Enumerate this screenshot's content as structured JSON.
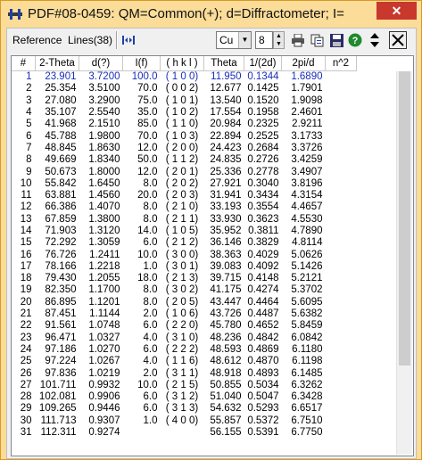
{
  "window": {
    "title": "PDF#08-0459: QM=Common(+); d=Diffractometer; I=...",
    "close_label": "✕"
  },
  "toolbar": {
    "reference_label": "Reference",
    "lines_label": "Lines(38)",
    "element_value": "Cu",
    "number_value": "8"
  },
  "table": {
    "columns": [
      "#",
      "2-Theta",
      "d(?)",
      "I(f)",
      "( h k l )",
      "Theta",
      "1/(2d)",
      "2pi/d",
      "n^2"
    ],
    "rows": [
      [
        "1",
        "23.901",
        "3.7200",
        "100.0",
        "( 1 0 0)",
        "11.950",
        "0.1344",
        "1.6890",
        ""
      ],
      [
        "2",
        "25.354",
        "3.5100",
        "70.0",
        "( 0 0 2)",
        "12.677",
        "0.1425",
        "1.7901",
        ""
      ],
      [
        "3",
        "27.080",
        "3.2900",
        "75.0",
        "( 1 0 1)",
        "13.540",
        "0.1520",
        "1.9098",
        ""
      ],
      [
        "4",
        "35.107",
        "2.5540",
        "35.0",
        "( 1 0 2)",
        "17.554",
        "0.1958",
        "2.4601",
        ""
      ],
      [
        "5",
        "41.968",
        "2.1510",
        "85.0",
        "( 1 1 0)",
        "20.984",
        "0.2325",
        "2.9211",
        ""
      ],
      [
        "6",
        "45.788",
        "1.9800",
        "70.0",
        "( 1 0 3)",
        "22.894",
        "0.2525",
        "3.1733",
        ""
      ],
      [
        "7",
        "48.845",
        "1.8630",
        "12.0",
        "( 2 0 0)",
        "24.423",
        "0.2684",
        "3.3726",
        ""
      ],
      [
        "8",
        "49.669",
        "1.8340",
        "50.0",
        "( 1 1 2)",
        "24.835",
        "0.2726",
        "3.4259",
        ""
      ],
      [
        "9",
        "50.673",
        "1.8000",
        "12.0",
        "( 2 0 1)",
        "25.336",
        "0.2778",
        "3.4907",
        ""
      ],
      [
        "10",
        "55.842",
        "1.6450",
        "8.0",
        "( 2 0 2)",
        "27.921",
        "0.3040",
        "3.8196",
        ""
      ],
      [
        "11",
        "63.881",
        "1.4560",
        "20.0",
        "( 2 0 3)",
        "31.941",
        "0.3434",
        "4.3154",
        ""
      ],
      [
        "12",
        "66.386",
        "1.4070",
        "8.0",
        "( 2 1 0)",
        "33.193",
        "0.3554",
        "4.4657",
        ""
      ],
      [
        "13",
        "67.859",
        "1.3800",
        "8.0",
        "( 2 1 1)",
        "33.930",
        "0.3623",
        "4.5530",
        ""
      ],
      [
        "14",
        "71.903",
        "1.3120",
        "14.0",
        "( 1 0 5)",
        "35.952",
        "0.3811",
        "4.7890",
        ""
      ],
      [
        "15",
        "72.292",
        "1.3059",
        "6.0",
        "( 2 1 2)",
        "36.146",
        "0.3829",
        "4.8114",
        ""
      ],
      [
        "16",
        "76.726",
        "1.2411",
        "10.0",
        "( 3 0 0)",
        "38.363",
        "0.4029",
        "5.0626",
        ""
      ],
      [
        "17",
        "78.166",
        "1.2218",
        "1.0",
        "( 3 0 1)",
        "39.083",
        "0.4092",
        "5.1426",
        ""
      ],
      [
        "18",
        "79.430",
        "1.2055",
        "18.0",
        "( 2 1 3)",
        "39.715",
        "0.4148",
        "5.2121",
        ""
      ],
      [
        "19",
        "82.350",
        "1.1700",
        "8.0",
        "( 3 0 2)",
        "41.175",
        "0.4274",
        "5.3702",
        ""
      ],
      [
        "20",
        "86.895",
        "1.1201",
        "8.0",
        "( 2 0 5)",
        "43.447",
        "0.4464",
        "5.6095",
        ""
      ],
      [
        "21",
        "87.451",
        "1.1144",
        "2.0",
        "( 1 0 6)",
        "43.726",
        "0.4487",
        "5.6382",
        ""
      ],
      [
        "22",
        "91.561",
        "1.0748",
        "6.0",
        "( 2 2 0)",
        "45.780",
        "0.4652",
        "5.8459",
        ""
      ],
      [
        "23",
        "96.471",
        "1.0327",
        "4.0",
        "( 3 1 0)",
        "48.236",
        "0.4842",
        "6.0842",
        ""
      ],
      [
        "24",
        "97.186",
        "1.0270",
        "6.0",
        "( 2 2 2)",
        "48.593",
        "0.4869",
        "6.1180",
        ""
      ],
      [
        "25",
        "97.224",
        "1.0267",
        "4.0",
        "( 1 1 6)",
        "48.612",
        "0.4870",
        "6.1198",
        ""
      ],
      [
        "26",
        "97.836",
        "1.0219",
        "2.0",
        "( 3 1 1)",
        "48.918",
        "0.4893",
        "6.1485",
        ""
      ],
      [
        "27",
        "101.711",
        "0.9932",
        "10.0",
        "( 2 1 5)",
        "50.855",
        "0.5034",
        "6.3262",
        ""
      ],
      [
        "28",
        "102.081",
        "0.9906",
        "6.0",
        "( 3 1 2)",
        "51.040",
        "0.5047",
        "6.3428",
        ""
      ],
      [
        "29",
        "109.265",
        "0.9446",
        "6.0",
        "( 3 1 3)",
        "54.632",
        "0.5293",
        "6.6517",
        ""
      ],
      [
        "30",
        "111.713",
        "0.9307",
        "1.0",
        "( 4 0 0)",
        "55.857",
        "0.5372",
        "6.7510",
        ""
      ],
      [
        "31",
        "112.311",
        "0.9274",
        "",
        "",
        "56.155",
        "0.5391",
        "6.7750",
        ""
      ]
    ]
  }
}
